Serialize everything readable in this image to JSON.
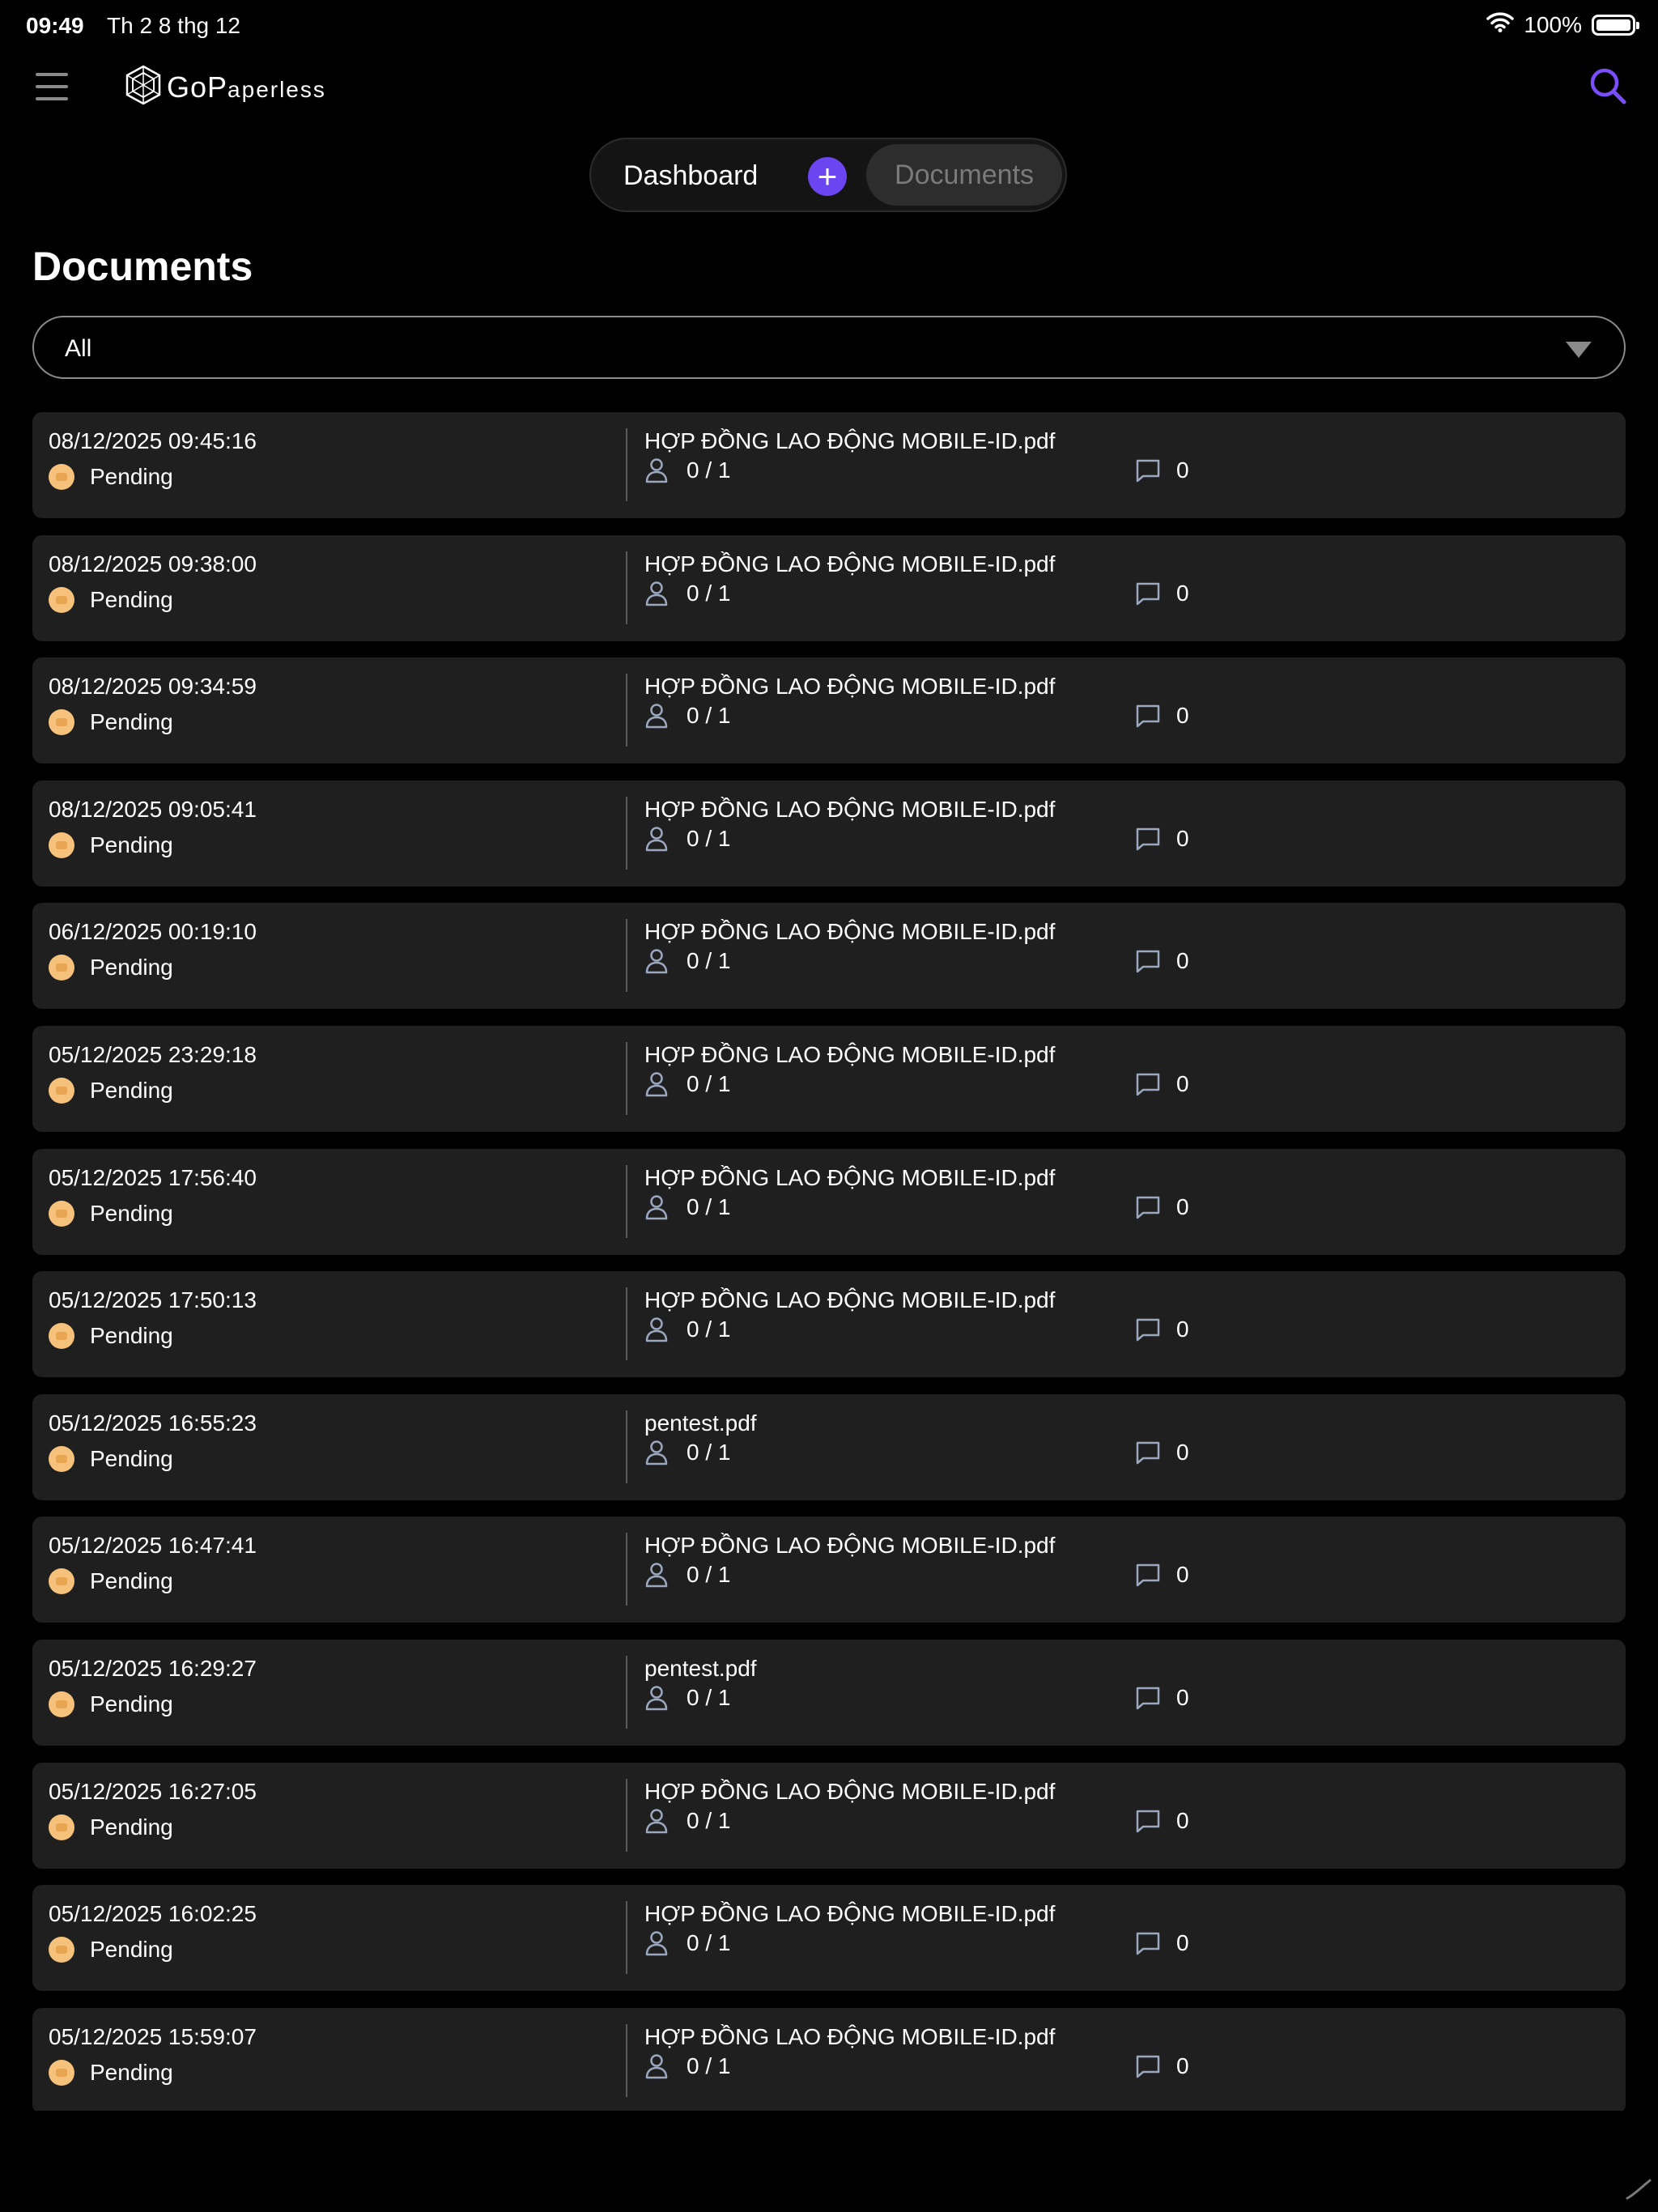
{
  "status_bar": {
    "time": "09:49",
    "date": "Th 2 8 thg 12",
    "battery": "100%"
  },
  "header": {
    "logo_text_prefix": "GoP",
    "logo_text_rest": "aperless"
  },
  "nav": {
    "dashboard": "Dashboard",
    "add": "+",
    "documents": "Documents"
  },
  "page": {
    "title": "Documents"
  },
  "filter": {
    "value": "All"
  },
  "colors": {
    "accent": "#6a45f0",
    "pending": "#f6c27b",
    "card": "#1f1f1f"
  },
  "documents": [
    {
      "date": "08/12/2025 09:45:16",
      "status": "Pending",
      "name": "HỢP ĐỒNG LAO ĐỘNG MOBILE-ID.pdf",
      "signers": "0 / 1",
      "comments": "0"
    },
    {
      "date": "08/12/2025 09:38:00",
      "status": "Pending",
      "name": "HỢP ĐỒNG LAO ĐỘNG MOBILE-ID.pdf",
      "signers": "0 / 1",
      "comments": "0"
    },
    {
      "date": "08/12/2025 09:34:59",
      "status": "Pending",
      "name": "HỢP ĐỒNG LAO ĐỘNG MOBILE-ID.pdf",
      "signers": "0 / 1",
      "comments": "0"
    },
    {
      "date": "08/12/2025 09:05:41",
      "status": "Pending",
      "name": "HỢP ĐỒNG LAO ĐỘNG MOBILE-ID.pdf",
      "signers": "0 / 1",
      "comments": "0"
    },
    {
      "date": "06/12/2025 00:19:10",
      "status": "Pending",
      "name": "HỢP ĐỒNG LAO ĐỘNG MOBILE-ID.pdf",
      "signers": "0 / 1",
      "comments": "0"
    },
    {
      "date": "05/12/2025 23:29:18",
      "status": "Pending",
      "name": "HỢP ĐỒNG LAO ĐỘNG MOBILE-ID.pdf",
      "signers": "0 / 1",
      "comments": "0"
    },
    {
      "date": "05/12/2025 17:56:40",
      "status": "Pending",
      "name": "HỢP ĐỒNG LAO ĐỘNG MOBILE-ID.pdf",
      "signers": "0 / 1",
      "comments": "0"
    },
    {
      "date": "05/12/2025 17:50:13",
      "status": "Pending",
      "name": "HỢP ĐỒNG LAO ĐỘNG MOBILE-ID.pdf",
      "signers": "0 / 1",
      "comments": "0"
    },
    {
      "date": "05/12/2025 16:55:23",
      "status": "Pending",
      "name": "pentest.pdf",
      "signers": "0 / 1",
      "comments": "0"
    },
    {
      "date": "05/12/2025 16:47:41",
      "status": "Pending",
      "name": "HỢP ĐỒNG LAO ĐỘNG MOBILE-ID.pdf",
      "signers": "0 / 1",
      "comments": "0"
    },
    {
      "date": "05/12/2025 16:29:27",
      "status": "Pending",
      "name": "pentest.pdf",
      "signers": "0 / 1",
      "comments": "0"
    },
    {
      "date": "05/12/2025 16:27:05",
      "status": "Pending",
      "name": "HỢP ĐỒNG LAO ĐỘNG MOBILE-ID.pdf",
      "signers": "0 / 1",
      "comments": "0"
    },
    {
      "date": "05/12/2025 16:02:25",
      "status": "Pending",
      "name": "HỢP ĐỒNG LAO ĐỘNG MOBILE-ID.pdf",
      "signers": "0 / 1",
      "comments": "0"
    },
    {
      "date": "05/12/2025 15:59:07",
      "status": "Pending",
      "name": "HỢP ĐỒNG LAO ĐỘNG MOBILE-ID.pdf",
      "signers": "0 / 1",
      "comments": "0"
    }
  ]
}
